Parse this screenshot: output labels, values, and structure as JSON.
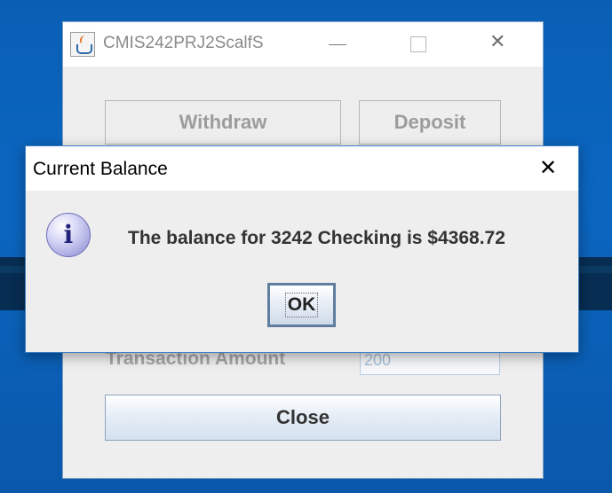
{
  "main_window": {
    "title": "CMIS242PRJ2ScalfS",
    "buttons": {
      "withdraw": "Withdraw",
      "deposit": "Deposit",
      "close": "Close"
    },
    "transaction_amount_label": "Transaction Amount",
    "transaction_amount_value": "200"
  },
  "dialog": {
    "title": "Current Balance",
    "message": "The balance for 3242 Checking is $4368.72",
    "ok_label": "OK",
    "icon": "info-icon"
  },
  "icons": {
    "minimize": "minimize-icon",
    "maximize": "maximize-icon",
    "close": "close-icon",
    "app": "java-icon"
  },
  "colors": {
    "desktop": "#0a5fb4",
    "dialog_border": "#3a7fc6"
  }
}
